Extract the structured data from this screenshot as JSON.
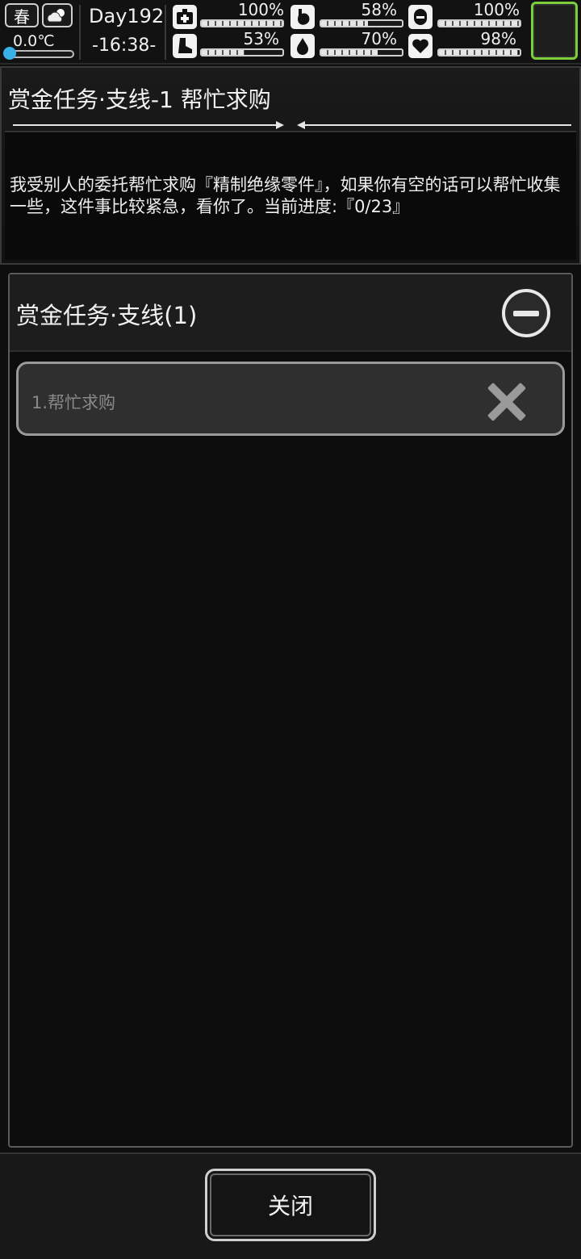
{
  "status": {
    "season": "春",
    "temperature": "0.0℃",
    "temperature_level": 0.1,
    "day": "Day192",
    "time": "-16:38-",
    "stats": [
      {
        "id": "health",
        "icon": "medkit-icon",
        "value": "100%",
        "level": 1.0
      },
      {
        "id": "hunger",
        "icon": "stomach-icon",
        "value": "58%",
        "level": 0.58
      },
      {
        "id": "immunity",
        "icon": "pill-icon",
        "value": "100%",
        "level": 1.0
      },
      {
        "id": "stamina",
        "icon": "boot-icon",
        "value": "53%",
        "level": 0.53
      },
      {
        "id": "thirst",
        "icon": "water-drop-icon",
        "value": "70%",
        "level": 0.7
      },
      {
        "id": "mood",
        "icon": "heart-icon",
        "value": "98%",
        "level": 0.98
      }
    ]
  },
  "quest": {
    "title": "赏金任务·支线-1 帮忙求购",
    "description": "我受别人的委托帮忙求购『精制绝缘零件』，如果你有空的话可以帮忙收集一些，这件事比较紧急，看你了。当前进度:『0/23』"
  },
  "group": {
    "title": "赏金任务·支线(1)",
    "items": [
      {
        "label": "1.帮忙求购"
      }
    ]
  },
  "footer": {
    "close_label": "关闭"
  }
}
